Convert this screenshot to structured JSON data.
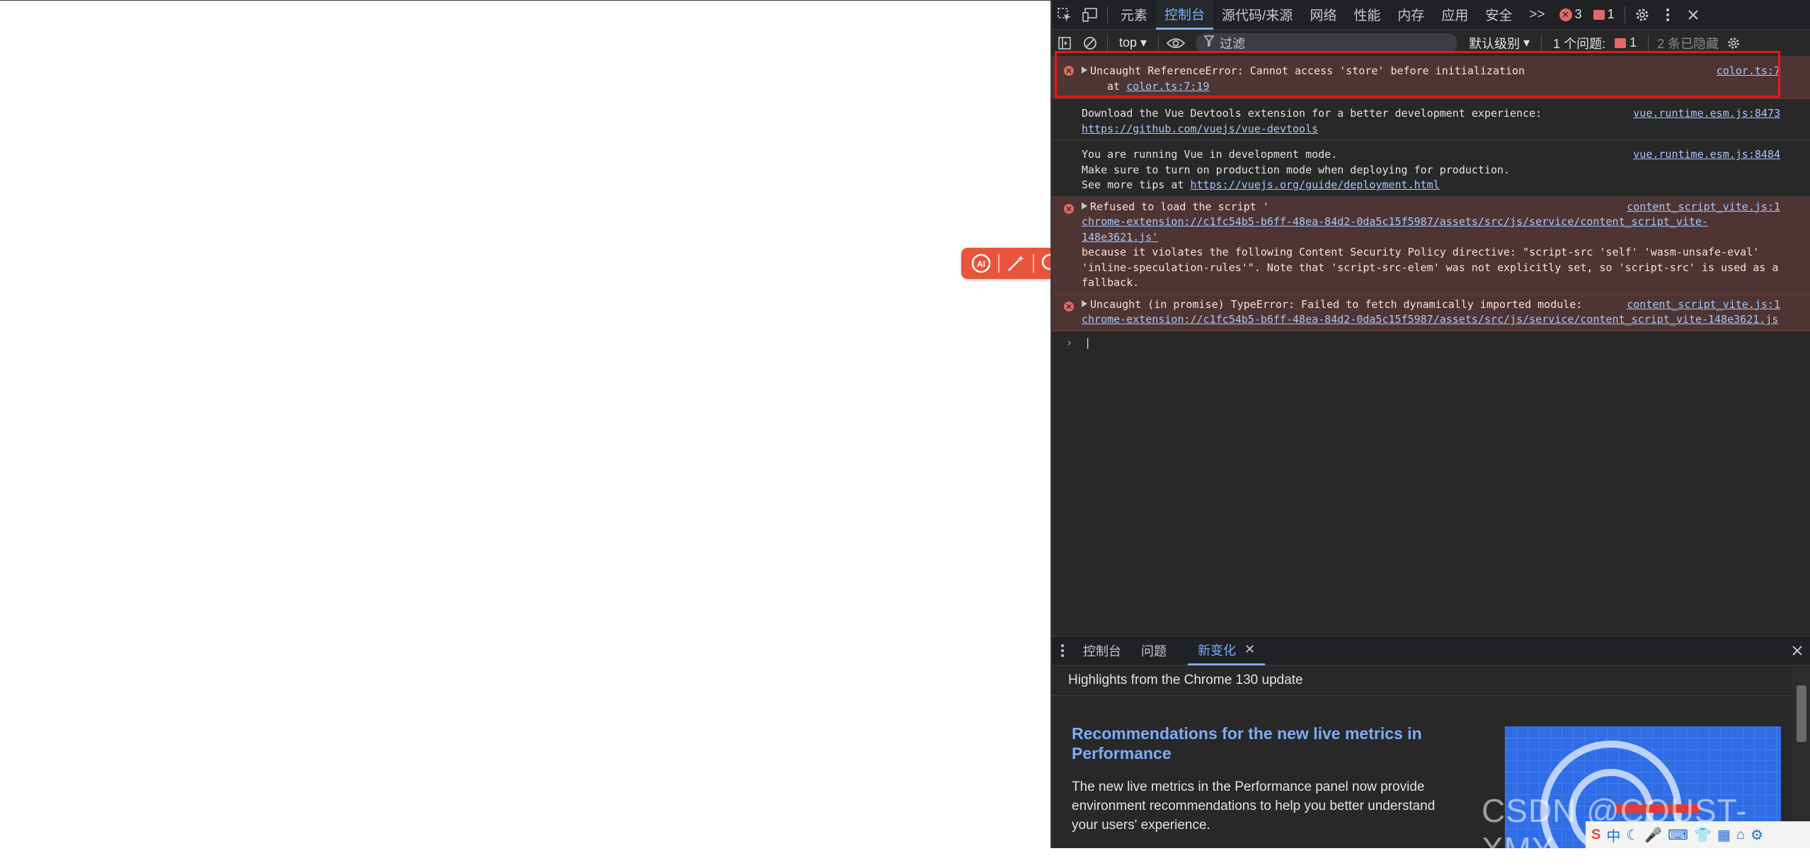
{
  "devtools": {
    "tabs": [
      "元素",
      "控制台",
      "源代码/来源",
      "网络",
      "性能",
      "内存",
      "应用",
      "安全"
    ],
    "more": ">>",
    "error_count": "3",
    "issue_count": "1",
    "toolbar": {
      "context": "top",
      "filter_placeholder": "过滤",
      "levels": "默认级别",
      "issues_label": "1 个问题:",
      "issues_count": "1",
      "hidden": "2 条已隐藏"
    },
    "console": {
      "messages": [
        {
          "line1": "Uncaught ReferenceError: Cannot access 'store' before initialization",
          "line2_prefix": "at ",
          "line2_link": "color.ts:7:19",
          "source": "color.ts:7"
        },
        {
          "line1": "Download the Vue Devtools extension for a better development experience:",
          "link": "https://github.com/vuejs/vue-devtools",
          "source": "vue.runtime.esm.js:8473"
        },
        {
          "line1": "You are running Vue in development mode.",
          "line2": "Make sure to turn on production mode when deploying for production.",
          "line3_prefix": "See more tips at ",
          "line3_link": "https://vuejs.org/guide/deployment.html",
          "source": "vue.runtime.esm.js:8484"
        },
        {
          "line1": "Refused to load the script '",
          "link": "chrome-extension://c1fc54b5-b6ff-48ea-84d2-0da5c15f5987/assets/src/js/service/content_script_vite-148e3621.js'",
          "line3": "because it violates the following Content Security Policy directive: \"script-src 'self' 'wasm-unsafe-eval'",
          "line4": "'inline-speculation-rules'\". Note that 'script-src-elem' was not explicitly set, so 'script-src' is used as a",
          "line5": "fallback.",
          "source": "content_script_vite.js:1"
        },
        {
          "line1": "Uncaught (in promise) TypeError: Failed to fetch dynamically imported module:",
          "link": "chrome-extension://c1fc54b5-b6ff-48ea-84d2-0da5c15f5987/assets/src/js/service/content_script_vite-148e3621.js",
          "source": "content_script_vite.js:1"
        }
      ]
    },
    "drawer": {
      "tabs": [
        "控制台",
        "问题",
        "新变化"
      ],
      "header": "Highlights from the Chrome 130 update",
      "article_title": "Recommendations for the new live metrics in Performance",
      "article_text": "The new live metrics in the Performance panel now provide environment recommendations to help you better understand your users' experience."
    }
  },
  "watermark": "CSDN @COUST-XMY",
  "tray": {
    "ime": "中"
  },
  "colors": {
    "accent": "#7cacf8",
    "error": "#e46962",
    "highlight": "#e81919",
    "float_toolbar": "#e9553b"
  }
}
